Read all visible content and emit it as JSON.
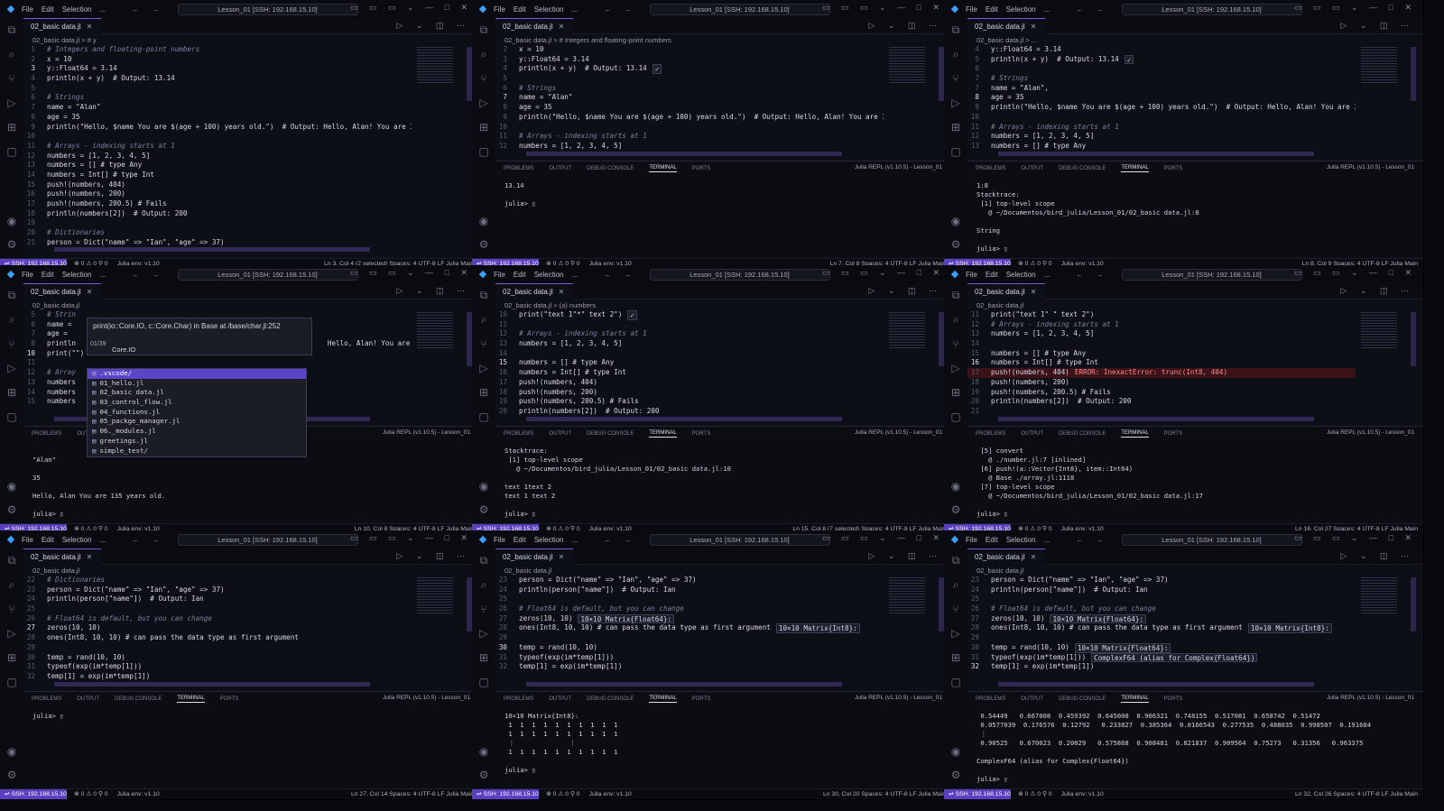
{
  "common": {
    "menu": [
      "File",
      "Edit",
      "Selection",
      "..."
    ],
    "search": "Lesson_01 [SSH: 192.168.15.10]",
    "tab": "02_basic data.jl",
    "panel_tabs": [
      "PROBLEMS",
      "OUTPUT",
      "DEBUG CONSOLE",
      "TERMINAL",
      "PORTS"
    ],
    "repl": "Julia REPL (v1.10.5) - Lesson_01",
    "remote": "SSH: 192.168.15.10",
    "problems": "⊗ 0 ⚠ 0   ⚲ 0",
    "env": "Julia env: v1.10"
  },
  "panes": [
    {
      "breadcrumb": "02_basic data.jl > # y",
      "lines": [
        {
          "n": "1",
          "t": "# Integers and floating-point numbers",
          "c": true
        },
        {
          "n": "2",
          "t": "x = 10"
        },
        {
          "n": "3",
          "t": "y::Float64 = 3.14",
          "cur": true
        },
        {
          "n": "4",
          "t": "println(x + y)  # Output: 13.14",
          "cm_tail": true
        },
        {
          "n": "5",
          "t": ""
        },
        {
          "n": "6",
          "t": "# Strings",
          "c": true
        },
        {
          "n": "7",
          "t": "name = \"Alan\""
        },
        {
          "n": "8",
          "t": "age = 35"
        },
        {
          "n": "9",
          "t": "println(\"Hello, $name You are $(age + 100) years old.\")  # Output: Hello, Alan! You are 35"
        },
        {
          "n": "10",
          "t": ""
        },
        {
          "n": "11",
          "t": "# Arrays - indexing starts at 1",
          "c": true
        },
        {
          "n": "12",
          "t": "numbers = [1, 2, 3, 4, 5]"
        },
        {
          "n": "13",
          "t": "numbers = [] # type Any"
        },
        {
          "n": "14",
          "t": "numbers = Int[] # type Int"
        },
        {
          "n": "15",
          "t": "push!(numbers, 404)"
        },
        {
          "n": "16",
          "t": "push!(numbers, 200)"
        },
        {
          "n": "17",
          "t": "push!(numbers, 200.5) # Fails"
        },
        {
          "n": "18",
          "t": "println(numbers[2])  # Output: 200"
        },
        {
          "n": "19",
          "t": ""
        },
        {
          "n": "20",
          "t": "# Dictionaries",
          "c": true
        },
        {
          "n": "21",
          "t": "person = Dict(\"name\" => \"Ian\", \"age\" => 37)"
        }
      ],
      "panel": false,
      "terminal": [],
      "status": "Ln 3, Col 4 (2 selected)   Spaces: 4   UTF-8   LF   Julia   Main"
    },
    {
      "breadcrumb": "02_basic data.jl > # Integers and floating-point numbers",
      "lines": [
        {
          "n": "2",
          "t": "x = 10"
        },
        {
          "n": "3",
          "t": "y::Float64 = 3.14"
        },
        {
          "n": "4",
          "t": "println(x + y)  # Output: 13.14",
          "inline": "✓"
        },
        {
          "n": "5",
          "t": ""
        },
        {
          "n": "6",
          "t": "# Strings",
          "c": true
        },
        {
          "n": "7",
          "t": "name = \"Alan\"",
          "cur": true
        },
        {
          "n": "8",
          "t": "age = 35"
        },
        {
          "n": "9",
          "t": "println(\"Hello, $name You are $(age + 100) years old.\")  # Output: Hello, Alan! You are 35"
        },
        {
          "n": "10",
          "t": ""
        },
        {
          "n": "11",
          "t": "# Arrays - indexing starts at 1",
          "c": true
        },
        {
          "n": "12",
          "t": "numbers = [1, 2, 3, 4, 5]"
        }
      ],
      "panel": true,
      "terminal": [
        "13.14",
        "",
        "julia> ▯"
      ],
      "status": "Ln 7, Col 8   Spaces: 4   UTF-8   LF   Julia   Main"
    },
    {
      "breadcrumb": "02_basic data.jl > ...",
      "lines": [
        {
          "n": "4",
          "t": "y::Float64 = 3.14"
        },
        {
          "n": "5",
          "t": "println(x + y)  # Output: 13.14",
          "inline": "✓"
        },
        {
          "n": "6",
          "t": ""
        },
        {
          "n": "7",
          "t": "# Strings",
          "c": true
        },
        {
          "n": "7",
          "t": "name = \"Alan\","
        },
        {
          "n": "8",
          "t": "age = 35",
          "cur": true
        },
        {
          "n": "9",
          "t": "println(\"Hello, $name You are $(age + 100) years old.\")  # Output: Hello, Alan! You are 35"
        },
        {
          "n": "10",
          "t": ""
        },
        {
          "n": "11",
          "t": "# Arrays - indexing starts at 1",
          "c": true
        },
        {
          "n": "12",
          "t": "numbers = [1, 2, 3, 4, 5]"
        },
        {
          "n": "13",
          "t": "numbers = [] # type Any"
        }
      ],
      "panel": true,
      "terminal": [
        "1:8",
        "Stacktrace:",
        " [1] top-level scope",
        "   @ ~/Documentos/bird_julia/Lesson_01/02_basic data.jl:8",
        "",
        "String",
        "",
        "julia> ▯"
      ],
      "status": "Ln 8, Col 9   Spaces: 4   UTF-8   LF   Julia   Main"
    },
    {
      "breadcrumb": "02_basic data.jl",
      "lines": [
        {
          "n": "5",
          "t": "# Strin",
          "c": true
        },
        {
          "n": "6",
          "t": "name ="
        },
        {
          "n": "7",
          "t": "age ="
        },
        {
          "n": "8",
          "t": "println                                                             Hello, Alan! You are 35"
        },
        {
          "n": "10",
          "t": "print(\"\")",
          "cur": true
        },
        {
          "n": "11",
          "t": ""
        },
        {
          "n": "12",
          "t": "# Array",
          "c": true
        },
        {
          "n": "13",
          "t": "numbers"
        },
        {
          "n": "14",
          "t": "numbers"
        },
        {
          "n": "15",
          "t": "numbers"
        }
      ],
      "panel": true,
      "terminal": [
        "",
        "\"Alan\"",
        "",
        "35",
        "",
        "Hello, Alan You are 135 years old.",
        "",
        "julia> ▯"
      ],
      "status": "Ln 10, Col 8   Spaces: 4   UTF-8   LF   Julia   Main"
    },
    {
      "breadcrumb": "02_basic data.jl > (a) numbers",
      "lines": [
        {
          "n": "10",
          "t": "print(\"text 1\"*\" text 2\")",
          "inline": "✓"
        },
        {
          "n": "11",
          "t": ""
        },
        {
          "n": "12",
          "t": "# Arrays - indexing starts at 1",
          "c": true
        },
        {
          "n": "13",
          "t": "numbers = [1, 2, 3, 4, 5]"
        },
        {
          "n": "14",
          "t": ""
        },
        {
          "n": "15",
          "t": "numbers = [] # type Any",
          "cur": true
        },
        {
          "n": "16",
          "t": "numbers = Int[] # type Int"
        },
        {
          "n": "17",
          "t": "push!(numbers, 404)"
        },
        {
          "n": "18",
          "t": "push!(numbers, 200)"
        },
        {
          "n": "19",
          "t": "push!(numbers, 200.5) # Fails"
        },
        {
          "n": "20",
          "t": "println(numbers[2])  # Output: 200"
        }
      ],
      "panel": true,
      "terminal": [
        "Stacktrace:",
        " [1] top-level scope",
        "   @ ~/Documentos/bird_julia/Lesson_01/02_basic data.jl:10",
        "",
        "text 1text 2",
        "text 1 text 2",
        "",
        "julia> ▯"
      ],
      "status": "Ln 15, Col 8 (7 selected)   Spaces: 4   UTF-8   LF   Julia   Main"
    },
    {
      "breadcrumb": "02_basic data.jl",
      "lines": [
        {
          "n": "11",
          "t": "print(\"text 1\" \" text 2\")"
        },
        {
          "n": "12",
          "t": "# Arrays - indexing starts at 1",
          "c": true
        },
        {
          "n": "13",
          "t": "numbers = [1, 2, 3, 4, 5]"
        },
        {
          "n": "14",
          "t": ""
        },
        {
          "n": "15",
          "t": "numbers = [] # type Any"
        },
        {
          "n": "16",
          "t": "numbers = Int[] # type Int",
          "cur": true
        },
        {
          "n": "17",
          "t": "push!(numbers, 404)",
          "err": "ERROR: InexactError: trunc(Int8, 404)"
        },
        {
          "n": "18",
          "t": "push!(numbers, 200)"
        },
        {
          "n": "19",
          "t": "push!(numbers, 200.5) # Fails"
        },
        {
          "n": "20",
          "t": "println(numbers[2])  # Output: 200"
        },
        {
          "n": "21",
          "t": ""
        }
      ],
      "panel": true,
      "terminal": [
        " [5] convert",
        "   @ ./number.jl:7 [inlined]",
        " [6] push!(a::Vector{Int8}, item::Int64)",
        "   @ Base ./array.jl:1118",
        " [7] top-level scope",
        "   @ ~/Documentos/bird_julia/Lesson_01/02_basic data.jl:17",
        "",
        "julia> ▯"
      ],
      "status": "Ln 16, Col 27   Spaces: 4   UTF-8   LF   Julia   Main"
    },
    {
      "breadcrumb": "02_basic data.jl",
      "lines": [
        {
          "n": "22",
          "t": "# Dictionaries",
          "c": true
        },
        {
          "n": "23",
          "t": "person = Dict(\"name\" => \"Ian\", \"age\" => 37)"
        },
        {
          "n": "24",
          "t": "println(person[\"name\"])  # Output: Ian"
        },
        {
          "n": "25",
          "t": ""
        },
        {
          "n": "26",
          "t": "# Float64 is default, but you can change",
          "c": true
        },
        {
          "n": "27",
          "t": "zeros(10, 10)",
          "cur": true
        },
        {
          "n": "28",
          "t": "ones(Int8, 10, 10) # can pass the data type as first argument"
        },
        {
          "n": "29",
          "t": ""
        },
        {
          "n": "30",
          "t": "temp = rand(10, 10)"
        },
        {
          "n": "31",
          "t": "typeof(exp(im*temp[1]))"
        },
        {
          "n": "32",
          "t": "temp[1] = exp(im*temp[1])"
        }
      ],
      "panel": true,
      "terminal": [
        "julia> ▯"
      ],
      "status": "Ln 27, Col 14   Spaces: 4   UTF-8   LF   Julia   Main"
    },
    {
      "breadcrumb": "02_basic data.jl",
      "lines": [
        {
          "n": "23",
          "t": "person = Dict(\"name\" => \"Ian\", \"age\" => 37)"
        },
        {
          "n": "24",
          "t": "println(person[\"name\"])  # Output: Ian"
        },
        {
          "n": "25",
          "t": ""
        },
        {
          "n": "26",
          "t": "# Float64 is default, but you can change",
          "c": true
        },
        {
          "n": "27",
          "t": "zeros(10, 10)",
          "inline": "10×10 Matrix{Float64}:"
        },
        {
          "n": "28",
          "t": "ones(Int8, 10, 10) # can pass the data type as first argument",
          "inline": "10×10 Matrix{Int8}:"
        },
        {
          "n": "29",
          "t": ""
        },
        {
          "n": "30",
          "t": "temp = rand(10, 10)",
          "cur": true
        },
        {
          "n": "31",
          "t": "typeof(exp(im*temp[1]))"
        },
        {
          "n": "32",
          "t": "temp[1] = exp(im*temp[1])"
        }
      ],
      "panel": true,
      "terminal": [
        "10×10 Matrix{Int8}:",
        " 1  1  1  1  1  1  1  1  1  1",
        " 1  1  1  1  1  1  1  1  1  1",
        " ⋮              ⋮",
        " 1  1  1  1  1  1  1  1  1  1",
        "",
        "julia> ▯"
      ],
      "status": "Ln 30, Col 20   Spaces: 4   UTF-8   LF   Julia   Main"
    },
    {
      "breadcrumb": "02_basic data.jl",
      "lines": [
        {
          "n": "23",
          "t": "person = Dict(\"name\" => \"Ian\", \"age\" => 37)"
        },
        {
          "n": "24",
          "t": "println(person[\"name\"])  # Output: Ian"
        },
        {
          "n": "25",
          "t": ""
        },
        {
          "n": "26",
          "t": "# Float64 is default, but you can change",
          "c": true
        },
        {
          "n": "27",
          "t": "zeros(10, 10)",
          "inline": "10×10 Matrix{Float64}:"
        },
        {
          "n": "28",
          "t": "ones(Int8, 10, 10) # can pass the data type as first argument",
          "inline": "10×10 Matrix{Int8}:"
        },
        {
          "n": "29",
          "t": ""
        },
        {
          "n": "30",
          "t": "temp = rand(10, 10)",
          "inline": "10×10 Matrix{Float64}:"
        },
        {
          "n": "31",
          "t": "typeof(exp(im*temp[1]))",
          "inline": "ComplexF64 (alias for Complex{Float64})"
        },
        {
          "n": "32",
          "t": "temp[1] = exp(im*temp[1])",
          "cur": true
        }
      ],
      "panel": true,
      "terminal": [
        " 0.54449   0.667008  0.459392  0.645008  0.906321  0.748155  0.517081  0.658742  0.51472",
        " 0.0577039  0.176576  0.12792   0.233827  0.385364  0.0166543  0.277535  0.488035  0.998507  0.191684",
        " ⋮",
        " 0.90525   0.670023  0.20029   0.575868  0.908481  0.821837  0.909564  0.75273   0.31356   0.963375",
        "",
        "ComplexF64 (alias for Complex{Float64})",
        "",
        "julia> ▯"
      ],
      "status": "Ln 32, Col 26   Spaces: 4   UTF-8   LF   Julia   Main"
    }
  ],
  "popup": {
    "sig": "print(io::Core.IO, c::Core.Char) in Base at /base/char.jl:252",
    "count": "01/39",
    "sub": "Core.IO"
  },
  "suggest": [
    ".vscode/",
    "01_hello.jl",
    "02_basic data.jl",
    "03_control_flow.jl",
    "04_functions.jl",
    "05_packge_manager.jl",
    "06._modules.jl",
    "greetings.jl",
    "simple_test/"
  ]
}
